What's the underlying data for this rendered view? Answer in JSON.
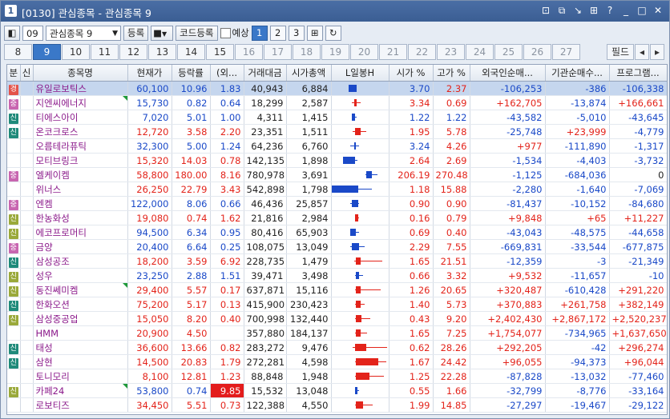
{
  "window": {
    "app_icon": "1",
    "title": "[0130] 관심종목 - 관심종목 9",
    "buttons": [
      "layout-icon",
      "copy-icon",
      "help-icon",
      "grid-icon",
      "question-icon",
      "minimize-icon",
      "maximize-icon",
      "close-icon"
    ]
  },
  "toolbar": {
    "group_no": "09",
    "group_name": "관심종목 9",
    "register_label": "등록",
    "code_register_label": "코드등록",
    "forecast_label": "예상",
    "pages": [
      "1",
      "2",
      "3"
    ],
    "active_page": "1"
  },
  "tabs": {
    "items": [
      "8",
      "9",
      "10",
      "11",
      "12",
      "13",
      "14",
      "15",
      "16",
      "17",
      "18",
      "19",
      "20",
      "21",
      "22",
      "23",
      "24",
      "25",
      "26",
      "27"
    ],
    "active": "9",
    "filter_label": "필드"
  },
  "colors": {
    "up": "#e3231a",
    "down": "#1a49c8",
    "accent": "#3a78c8"
  },
  "table": {
    "headers": [
      "분",
      "신",
      "종목명",
      "현재가",
      "등락률",
      "(외...",
      "거래대금",
      "시가총액",
      "L일봉H",
      "시가 %",
      "고가 %",
      "외국인순매...",
      "기관순매수...",
      "프로그램..."
    ],
    "rows": [
      {
        "badge": "경",
        "bc": "o",
        "name": "유일로보틱스",
        "price": "60,100",
        "rate": "10.96",
        "f": "1.83",
        "vol": "40,943",
        "cap": "6,884",
        "open": "3.70",
        "high": "2.37",
        "foreign": "-106,253",
        "inst": "-386",
        "prog": "-106,338",
        "dir": "down",
        "oc": "down",
        "hc": "red",
        "fc": "down",
        "ic": "down",
        "pc": "down",
        "candle": {
          "dir": "down",
          "lo": 0.3,
          "hi": 0.45,
          "b0": 0.3,
          "b1": 0.45
        },
        "sel": true,
        "corner": false
      },
      {
        "badge": "중",
        "bc": "p",
        "name": "지엔씨에너지",
        "price": "15,730",
        "rate": "0.82",
        "f": "0.64",
        "vol": "18,299",
        "cap": "2,587",
        "open": "3.34",
        "high": "0.69",
        "foreign": "+162,705",
        "inst": "-13,874",
        "prog": "+166,661",
        "dir": "down",
        "oc": "red",
        "hc": "red",
        "fc": "red",
        "ic": "down",
        "pc": "red",
        "candle": {
          "dir": "up",
          "lo": 0.36,
          "hi": 0.52,
          "b0": 0.4,
          "b1": 0.45
        },
        "corner": true
      },
      {
        "badge": "신",
        "bc": "g",
        "name": "티에스아이",
        "price": "7,020",
        "rate": "5.01",
        "f": "1.00",
        "vol": "4,311",
        "cap": "1,415",
        "open": "1.22",
        "high": "1.22",
        "foreign": "-43,582",
        "inst": "-5,010",
        "prog": "-43,645",
        "dir": "down",
        "oc": "down",
        "hc": "down",
        "fc": "down",
        "ic": "down",
        "pc": "down",
        "candle": {
          "dir": "down",
          "lo": 0.36,
          "hi": 0.45,
          "b0": 0.36,
          "b1": 0.42
        },
        "corner": false
      },
      {
        "badge": "신",
        "bc": "g",
        "name": "온코크로스",
        "price": "12,720",
        "rate": "3.58",
        "f": "2.20",
        "vol": "23,351",
        "cap": "1,511",
        "open": "1.95",
        "high": "5.78",
        "foreign": "-25,748",
        "inst": "+23,999",
        "prog": "-4,779",
        "dir": "red",
        "oc": "red",
        "hc": "red",
        "fc": "down",
        "ic": "red",
        "pc": "down",
        "candle": {
          "dir": "up",
          "lo": 0.38,
          "hi": 0.62,
          "b0": 0.42,
          "b1": 0.52
        },
        "corner": false
      },
      {
        "badge": "",
        "bc": "",
        "name": "오름테라퓨틱",
        "price": "32,300",
        "rate": "5.00",
        "f": "1.24",
        "vol": "64,236",
        "cap": "6,760",
        "open": "3.24",
        "high": "4.26",
        "foreign": "+977",
        "inst": "-111,890",
        "prog": "-1,317",
        "dir": "down",
        "oc": "down",
        "hc": "red",
        "fc": "red",
        "ic": "down",
        "pc": "down",
        "candle": {
          "dir": "down",
          "lo": 0.34,
          "hi": 0.5,
          "b0": 0.4,
          "b1": 0.44
        },
        "corner": false
      },
      {
        "badge": "",
        "bc": "",
        "name": "모티브링크",
        "price": "15,320",
        "rate": "14.03",
        "f": "0.78",
        "vol": "142,135",
        "cap": "1,898",
        "open": "2.64",
        "high": "2.69",
        "foreign": "-1,534",
        "inst": "-4,403",
        "prog": "-3,732",
        "dir": "red",
        "oc": "red",
        "hc": "red",
        "fc": "down",
        "ic": "down",
        "pc": "down",
        "candle": {
          "dir": "down",
          "lo": 0.2,
          "hi": 0.46,
          "b0": 0.2,
          "b1": 0.42
        },
        "corner": false
      },
      {
        "badge": "중",
        "bc": "p",
        "name": "엘케이켐",
        "price": "58,800",
        "rate": "180.00",
        "f": "8.16",
        "vol": "780,978",
        "cap": "3,691",
        "open": "206.19",
        "high": "270.48",
        "foreign": "-1,125",
        "inst": "-684,036",
        "prog": "0",
        "dir": "red",
        "oc": "red",
        "hc": "red",
        "fc": "down",
        "ic": "down",
        "pc": "plain",
        "candle": {
          "dir": "down",
          "lo": 0.6,
          "hi": 0.82,
          "b0": 0.62,
          "b1": 0.72
        },
        "corner": false
      },
      {
        "badge": "",
        "bc": "",
        "name": "위너스",
        "price": "26,250",
        "rate": "22.79",
        "f": "3.43",
        "vol": "542,898",
        "cap": "1,798",
        "open": "1.18",
        "high": "15.88",
        "foreign": "-2,280",
        "inst": "-1,640",
        "prog": "-7,069",
        "dir": "red",
        "oc": "red",
        "hc": "red",
        "fc": "down",
        "ic": "down",
        "pc": "down",
        "candle": {
          "dir": "down",
          "lo": 0.0,
          "hi": 0.72,
          "b0": 0.0,
          "b1": 0.48
        },
        "corner": false
      },
      {
        "badge": "중",
        "bc": "p",
        "name": "엔켐",
        "price": "122,000",
        "rate": "8.06",
        "f": "0.66",
        "vol": "46,436",
        "cap": "25,857",
        "open": "0.90",
        "high": "0.90",
        "foreign": "-81,437",
        "inst": "-10,152",
        "prog": "-84,680",
        "dir": "down",
        "oc": "red",
        "hc": "red",
        "fc": "down",
        "ic": "down",
        "pc": "down",
        "candle": {
          "dir": "down",
          "lo": 0.34,
          "hi": 0.5,
          "b0": 0.36,
          "b1": 0.48
        },
        "corner": false
      },
      {
        "badge": "신",
        "bc": "y",
        "name": "한농화성",
        "price": "19,080",
        "rate": "0.74",
        "f": "1.62",
        "vol": "21,816",
        "cap": "2,984",
        "open": "0.16",
        "high": "0.79",
        "foreign": "+9,848",
        "inst": "+65",
        "prog": "+11,227",
        "dir": "red",
        "oc": "red",
        "hc": "red",
        "fc": "red",
        "ic": "red",
        "pc": "red",
        "candle": {
          "dir": "up",
          "lo": 0.42,
          "hi": 0.5,
          "b0": 0.42,
          "b1": 0.48
        },
        "corner": false
      },
      {
        "badge": "신",
        "bc": "y",
        "name": "에코프로머티",
        "price": "94,500",
        "rate": "6.34",
        "f": "0.95",
        "vol": "80,416",
        "cap": "65,903",
        "open": "0.69",
        "high": "0.40",
        "foreign": "-43,043",
        "inst": "-48,575",
        "prog": "-44,658",
        "dir": "down",
        "oc": "red",
        "hc": "red",
        "fc": "down",
        "ic": "down",
        "pc": "down",
        "candle": {
          "dir": "down",
          "lo": 0.34,
          "hi": 0.5,
          "b0": 0.34,
          "b1": 0.44
        },
        "corner": false
      },
      {
        "badge": "중",
        "bc": "p",
        "name": "금양",
        "price": "20,400",
        "rate": "6.64",
        "f": "0.25",
        "vol": "108,075",
        "cap": "13,049",
        "open": "2.29",
        "high": "7.55",
        "foreign": "-669,831",
        "inst": "-33,544",
        "prog": "-677,875",
        "dir": "down",
        "oc": "red",
        "hc": "red",
        "fc": "down",
        "ic": "down",
        "pc": "down",
        "candle": {
          "dir": "down",
          "lo": 0.34,
          "hi": 0.6,
          "b0": 0.36,
          "b1": 0.5
        },
        "corner": false
      },
      {
        "badge": "신",
        "bc": "g",
        "name": "삼성공조",
        "price": "18,200",
        "rate": "3.59",
        "f": "6.92",
        "vol": "228,735",
        "cap": "1,479",
        "open": "1.65",
        "high": "21.51",
        "foreign": "-12,359",
        "inst": "-3",
        "prog": "-21,349",
        "dir": "red",
        "oc": "red",
        "hc": "red",
        "fc": "down",
        "ic": "down",
        "pc": "down",
        "candle": {
          "dir": "up",
          "lo": 0.4,
          "hi": 0.9,
          "b0": 0.44,
          "b1": 0.52
        },
        "corner": false
      },
      {
        "badge": "신",
        "bc": "y",
        "name": "성우",
        "price": "23,250",
        "rate": "2.88",
        "f": "1.51",
        "vol": "39,471",
        "cap": "3,498",
        "open": "0.66",
        "high": "3.32",
        "foreign": "+9,532",
        "inst": "-11,657",
        "prog": "-10",
        "dir": "down",
        "oc": "red",
        "hc": "red",
        "fc": "red",
        "ic": "down",
        "pc": "down",
        "candle": {
          "dir": "down",
          "lo": 0.42,
          "hi": 0.56,
          "b0": 0.44,
          "b1": 0.5
        },
        "corner": false
      },
      {
        "badge": "신",
        "bc": "y",
        "name": "동진쎄미켐",
        "price": "29,400",
        "rate": "5.57",
        "f": "0.17",
        "vol": "637,871",
        "cap": "15,116",
        "open": "1.26",
        "high": "20.65",
        "foreign": "+320,487",
        "inst": "-610,428",
        "prog": "+291,220",
        "dir": "red",
        "oc": "red",
        "hc": "red",
        "fc": "red",
        "ic": "down",
        "pc": "red",
        "candle": {
          "dir": "up",
          "lo": 0.42,
          "hi": 0.88,
          "b0": 0.44,
          "b1": 0.52
        },
        "corner": true
      },
      {
        "badge": "신",
        "bc": "g",
        "name": "한화오션",
        "price": "75,200",
        "rate": "5.17",
        "f": "0.13",
        "vol": "415,900",
        "cap": "230,423",
        "open": "1.40",
        "high": "5.73",
        "foreign": "+370,883",
        "inst": "+261,758",
        "prog": "+382,149",
        "dir": "red",
        "oc": "red",
        "hc": "red",
        "fc": "red",
        "ic": "red",
        "pc": "red",
        "candle": {
          "dir": "up",
          "lo": 0.42,
          "hi": 0.6,
          "b0": 0.44,
          "b1": 0.52
        },
        "corner": false
      },
      {
        "badge": "신",
        "bc": "y",
        "name": "삼성중공업",
        "price": "15,050",
        "rate": "8.20",
        "f": "0.40",
        "vol": "700,998",
        "cap": "132,440",
        "open": "0.43",
        "high": "9.20",
        "foreign": "+2,402,430",
        "inst": "+2,867,172",
        "prog": "+2,520,237",
        "dir": "red",
        "oc": "red",
        "hc": "red",
        "fc": "red",
        "ic": "red",
        "pc": "red",
        "candle": {
          "dir": "up",
          "lo": 0.42,
          "hi": 0.7,
          "b0": 0.44,
          "b1": 0.54
        },
        "corner": false
      },
      {
        "badge": "",
        "bc": "",
        "name": "HMM",
        "price": "20,900",
        "rate": "4.50",
        "f": "",
        "vol": "357,880",
        "cap": "184,137",
        "open": "1.65",
        "high": "7.25",
        "foreign": "+1,754,077",
        "inst": "-734,965",
        "prog": "+1,637,650",
        "dir": "red",
        "oc": "red",
        "hc": "red",
        "fc": "red",
        "ic": "down",
        "pc": "red",
        "candle": {
          "dir": "up",
          "lo": 0.42,
          "hi": 0.64,
          "b0": 0.44,
          "b1": 0.52
        },
        "corner": false
      },
      {
        "badge": "신",
        "bc": "g",
        "name": "태성",
        "price": "36,600",
        "rate": "13.66",
        "f": "0.82",
        "vol": "283,272",
        "cap": "9,476",
        "open": "0.62",
        "high": "28.26",
        "foreign": "+292,205",
        "inst": "-42",
        "prog": "+296,274",
        "dir": "red",
        "oc": "red",
        "hc": "red",
        "fc": "red",
        "ic": "down",
        "pc": "red",
        "candle": {
          "dir": "up",
          "lo": 0.38,
          "hi": 1.0,
          "b0": 0.42,
          "b1": 0.62
        },
        "corner": false
      },
      {
        "badge": "신",
        "bc": "g",
        "name": "삼현",
        "price": "14,500",
        "rate": "20.83",
        "f": "1.79",
        "vol": "272,281",
        "cap": "4,598",
        "open": "1.67",
        "high": "24.42",
        "foreign": "+96,055",
        "inst": "-94,373",
        "prog": "+96,044",
        "dir": "red",
        "oc": "red",
        "hc": "red",
        "fc": "red",
        "ic": "down",
        "pc": "red",
        "candle": {
          "dir": "up",
          "lo": 0.42,
          "hi": 0.98,
          "b0": 0.44,
          "b1": 0.84
        },
        "corner": false
      },
      {
        "badge": "",
        "bc": "",
        "name": "토니모리",
        "price": "8,100",
        "rate": "12.81",
        "f": "1.23",
        "vol": "88,848",
        "cap": "1,948",
        "open": "1.25",
        "high": "22.28",
        "foreign": "-87,828",
        "inst": "-13,032",
        "prog": "-77,460",
        "dir": "red",
        "oc": "red",
        "hc": "red",
        "fc": "down",
        "ic": "down",
        "pc": "down",
        "candle": {
          "dir": "up",
          "lo": 0.42,
          "hi": 0.94,
          "b0": 0.44,
          "b1": 0.68
        },
        "corner": false
      },
      {
        "badge": "신",
        "bc": "y",
        "name": "카페24",
        "price": "53,800",
        "rate": "0.74",
        "f": "9.85",
        "vol": "15,532",
        "cap": "13,048",
        "open": "0.55",
        "high": "1.66",
        "foreign": "-32,799",
        "inst": "-8,776",
        "prog": "-33,164",
        "dir": "down",
        "oc": "red",
        "hc": "red",
        "fc": "down",
        "ic": "down",
        "pc": "down",
        "candle": {
          "dir": "down",
          "lo": 0.42,
          "hi": 0.5,
          "b0": 0.42,
          "b1": 0.46
        },
        "corner": true,
        "alert": true
      },
      {
        "badge": "",
        "bc": "",
        "name": "로보티즈",
        "price": "34,450",
        "rate": "5.51",
        "f": "0.73",
        "vol": "122,388",
        "cap": "4,550",
        "open": "1.99",
        "high": "14.85",
        "foreign": "-27,297",
        "inst": "-19,467",
        "prog": "-29,122",
        "dir": "red",
        "oc": "red",
        "hc": "red",
        "fc": "down",
        "ic": "down",
        "pc": "down",
        "candle": {
          "dir": "up",
          "lo": 0.42,
          "hi": 0.74,
          "b0": 0.44,
          "b1": 0.56
        },
        "corner": false
      }
    ]
  }
}
